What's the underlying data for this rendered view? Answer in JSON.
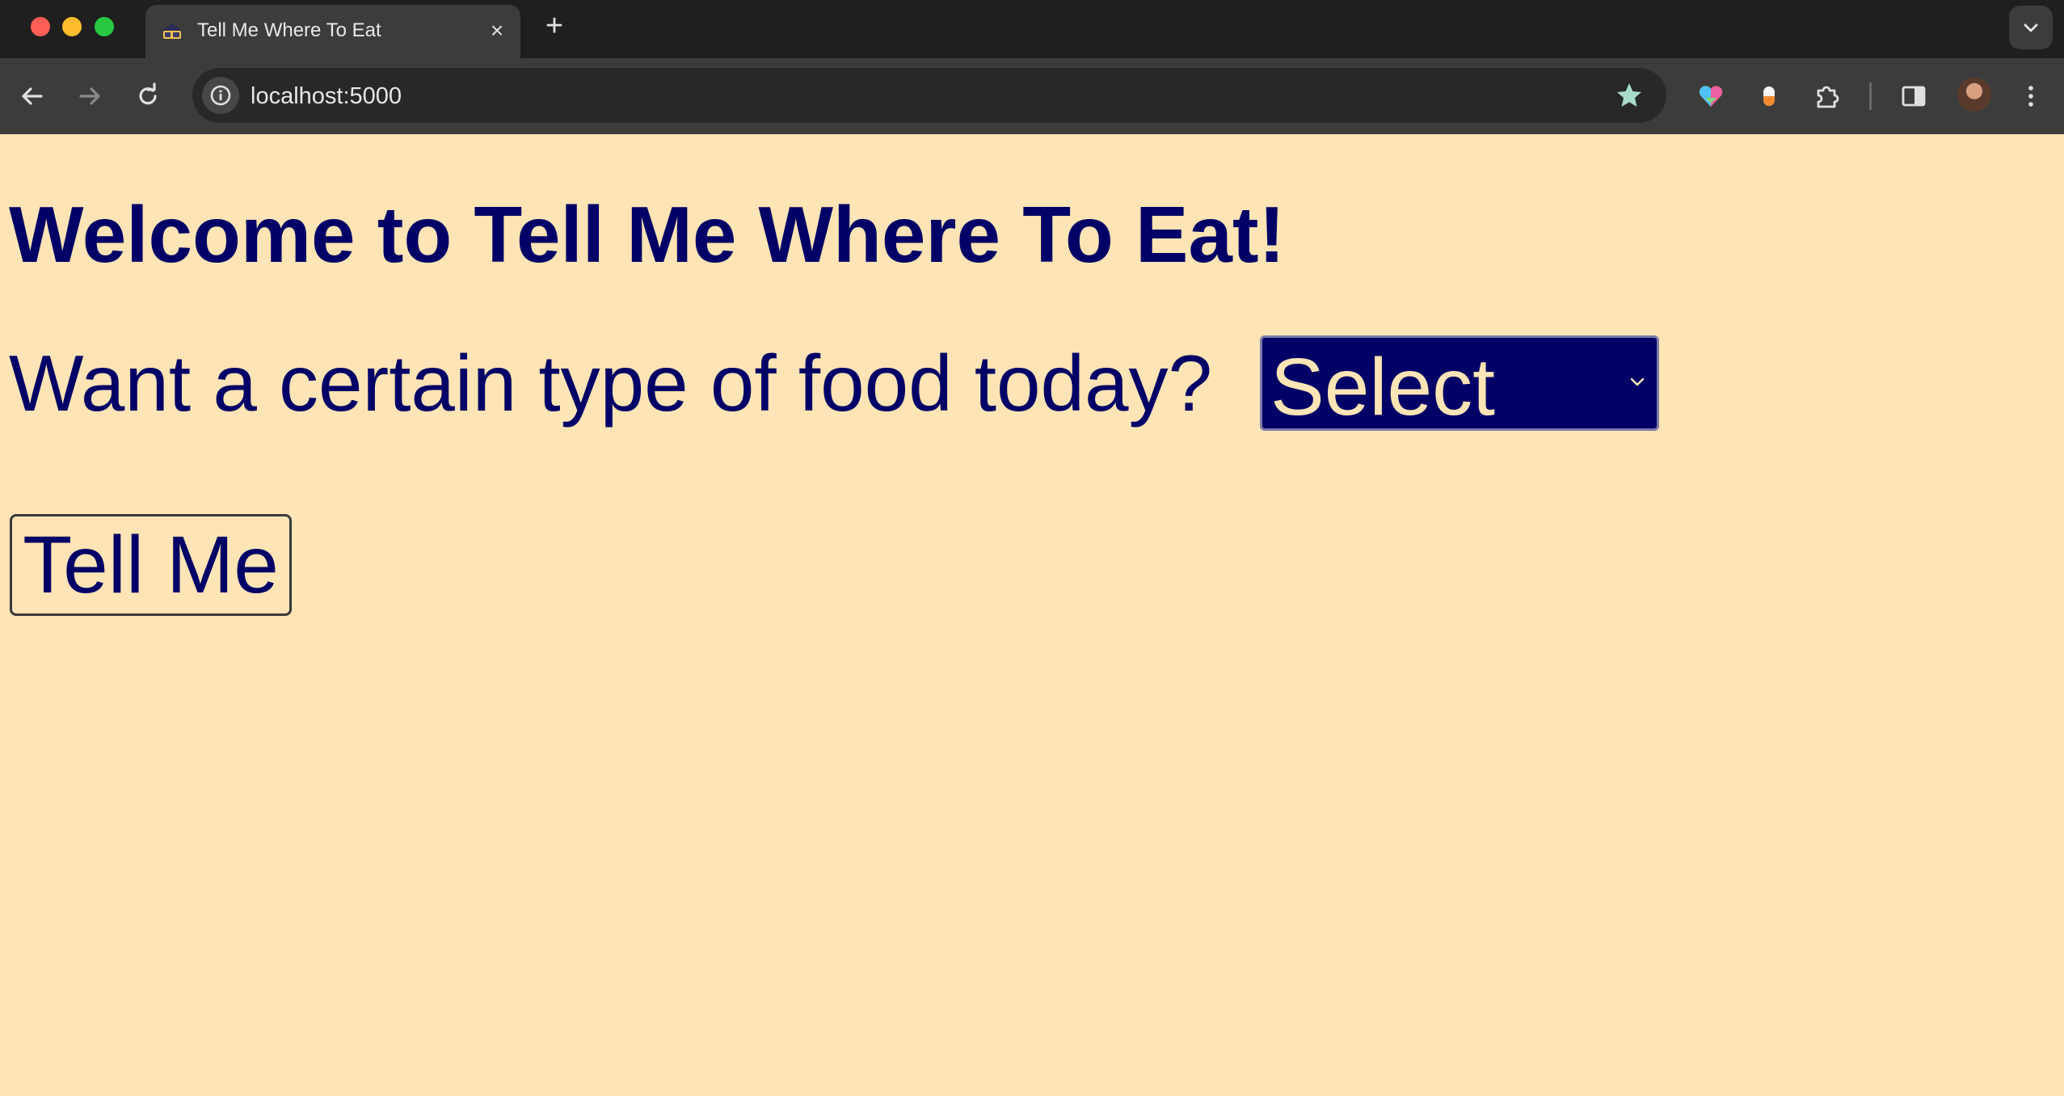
{
  "browser": {
    "tab": {
      "title": "Tell Me Where To Eat",
      "close_label": "×"
    },
    "new_tab_label": "+",
    "address_bar": {
      "url": "localhost:5000"
    },
    "icons": {
      "back": "arrow-left-icon",
      "forward": "arrow-right-icon",
      "reload": "reload-icon",
      "site_info": "info-icon",
      "bookmark": "star-icon",
      "extension_1": "heart-icon",
      "extension_2": "capsule-icon",
      "extensions": "puzzle-icon",
      "side_panel": "side-panel-icon",
      "profile": "avatar",
      "menu": "kebab-menu-icon",
      "tab_search": "chevron-down-icon"
    }
  },
  "page": {
    "title": "Welcome to Tell Me Where To Eat!",
    "food_question": "Want a certain type of food today?",
    "food_select": {
      "selected": "Select"
    },
    "submit_label": "Tell Me"
  },
  "colors": {
    "page_background": "#ffe4b5",
    "text_primary": "#000066",
    "select_background": "#000066",
    "select_text": "#ffe4b5"
  }
}
